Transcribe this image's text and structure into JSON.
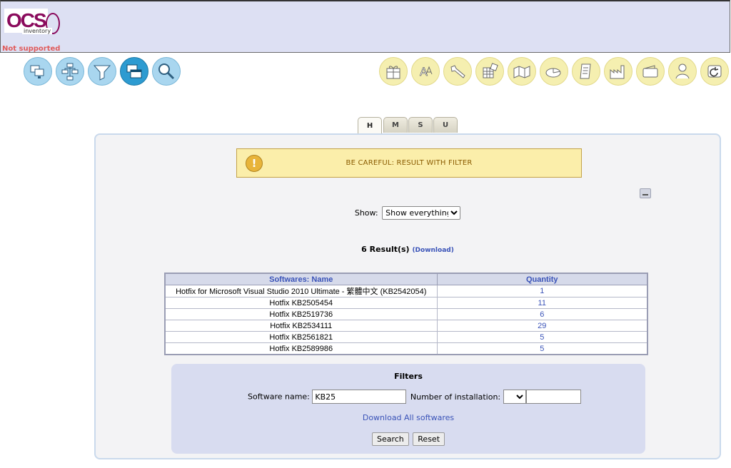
{
  "header": {
    "logo_text": "OCS",
    "logo_sub": "inventory",
    "not_supported": "Not supported"
  },
  "nav_left": [
    {
      "icon": "computers-icon"
    },
    {
      "icon": "network-icon"
    },
    {
      "icon": "filter-icon"
    },
    {
      "icon": "software-windows-icon",
      "active": true
    },
    {
      "icon": "search-magnifier-icon"
    }
  ],
  "nav_right": [
    {
      "icon": "package-gift-icon"
    },
    {
      "icon": "dictionary-icon"
    },
    {
      "icon": "wrench-icon"
    },
    {
      "icon": "registry-icon"
    },
    {
      "icon": "map-icon"
    },
    {
      "icon": "pie-chart-icon"
    },
    {
      "icon": "document-icon"
    },
    {
      "icon": "factory-icon"
    },
    {
      "icon": "wallet-icon"
    },
    {
      "icon": "user-plugin-icon"
    },
    {
      "icon": "logout-icon"
    }
  ],
  "tabs": [
    {
      "label": "H",
      "active": true
    },
    {
      "label": "M"
    },
    {
      "label": "S"
    },
    {
      "label": "U"
    }
  ],
  "warning": {
    "text": "BE CAREFUL: RESULT WITH FILTER"
  },
  "show": {
    "label": "Show:",
    "selected": "Show everything"
  },
  "results": {
    "count_text": "6 Result(s)",
    "download_link": "(Download)"
  },
  "table": {
    "columns": [
      "Softwares: Name",
      "Quantity"
    ],
    "rows": [
      {
        "name": "Hotfix for Microsoft Visual Studio 2010 Ultimate - 繁體中文 (KB2542054)",
        "quantity": "1"
      },
      {
        "name": "Hotfix KB2505454",
        "quantity": "11"
      },
      {
        "name": "Hotfix KB2519736",
        "quantity": "6"
      },
      {
        "name": "Hotfix KB2534111",
        "quantity": "29"
      },
      {
        "name": "Hotfix KB2561821",
        "quantity": "5"
      },
      {
        "name": "Hotfix KB2589986",
        "quantity": "5"
      }
    ]
  },
  "filters": {
    "title": "Filters",
    "software_name_label": "Software name:",
    "software_name_value": "KB25",
    "installations_label": "Number of installation:",
    "installations_value": "",
    "download_all": "Download All softwares",
    "search_button": "Search",
    "reset_button": "Reset"
  },
  "colors": {
    "header_bg": "#dde0f3",
    "link_blue": "#3a53b8",
    "warning_bg": "#fbeeaa",
    "nav_blue": "#a9d6ef",
    "nav_yellow": "#f5efb0"
  }
}
